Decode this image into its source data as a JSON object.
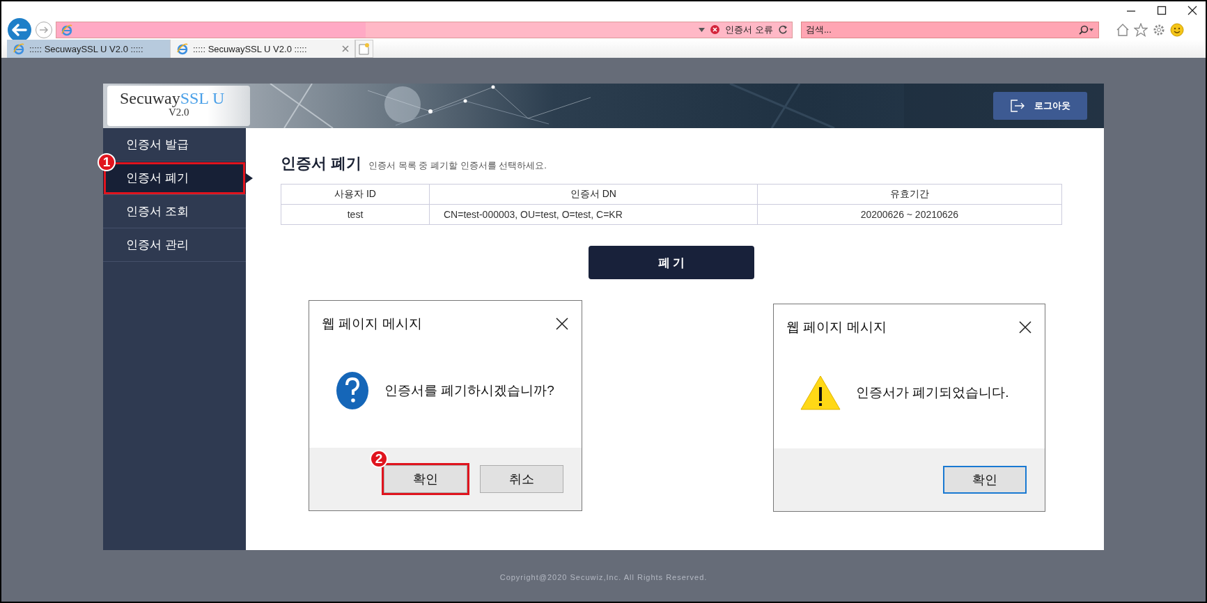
{
  "browser": {
    "status_text": "인증서 오류",
    "search_placeholder": "검색...",
    "tabs": [
      {
        "label": "::::: SecuwaySSL U V2.0 :::::",
        "selected": false
      },
      {
        "label": "::::: SecuwaySSL U V2.0 :::::",
        "selected": true
      }
    ]
  },
  "header": {
    "logo_name": "Secuway",
    "logo_accent": "SSL U",
    "logo_version": "V2.0",
    "logout_label": "로그아웃"
  },
  "sidebar": {
    "items": [
      {
        "label": "인증서 발급",
        "selected": false,
        "highlighted": false
      },
      {
        "label": "인증서 폐기",
        "selected": true,
        "highlighted": true,
        "marker": "1"
      },
      {
        "label": "인증서 조회",
        "selected": false,
        "highlighted": false
      },
      {
        "label": "인증서 관리",
        "selected": false,
        "highlighted": false
      }
    ]
  },
  "page": {
    "title": "인증서 폐기",
    "subtitle": "인증서 목록 중 폐기할 인증서를 선택하세요.",
    "table": {
      "columns": [
        "사용자 ID",
        "인증서 DN",
        "유효기간"
      ],
      "rows": [
        [
          "test",
          "CN=test-000003, OU=test, O=test, C=KR",
          "20200626 ~ 20210626"
        ]
      ]
    },
    "action_button": "폐 기"
  },
  "dialogs": [
    {
      "title": "웹 페이지 메시지",
      "kind": "question",
      "message": "인증서를 폐기하시겠습니까?",
      "buttons": [
        {
          "label": "확인",
          "focused": false,
          "highlighted": true,
          "marker": "2"
        },
        {
          "label": "취소",
          "focused": false,
          "highlighted": false
        }
      ]
    },
    {
      "title": "웹 페이지 메시지",
      "kind": "warning",
      "message": "인증서가 폐기되었습니다.",
      "buttons": [
        {
          "label": "확인",
          "focused": true,
          "highlighted": false
        }
      ]
    }
  ],
  "footer": "Copyright@2020 Secuwiz,Inc. All Rights Reserved."
}
